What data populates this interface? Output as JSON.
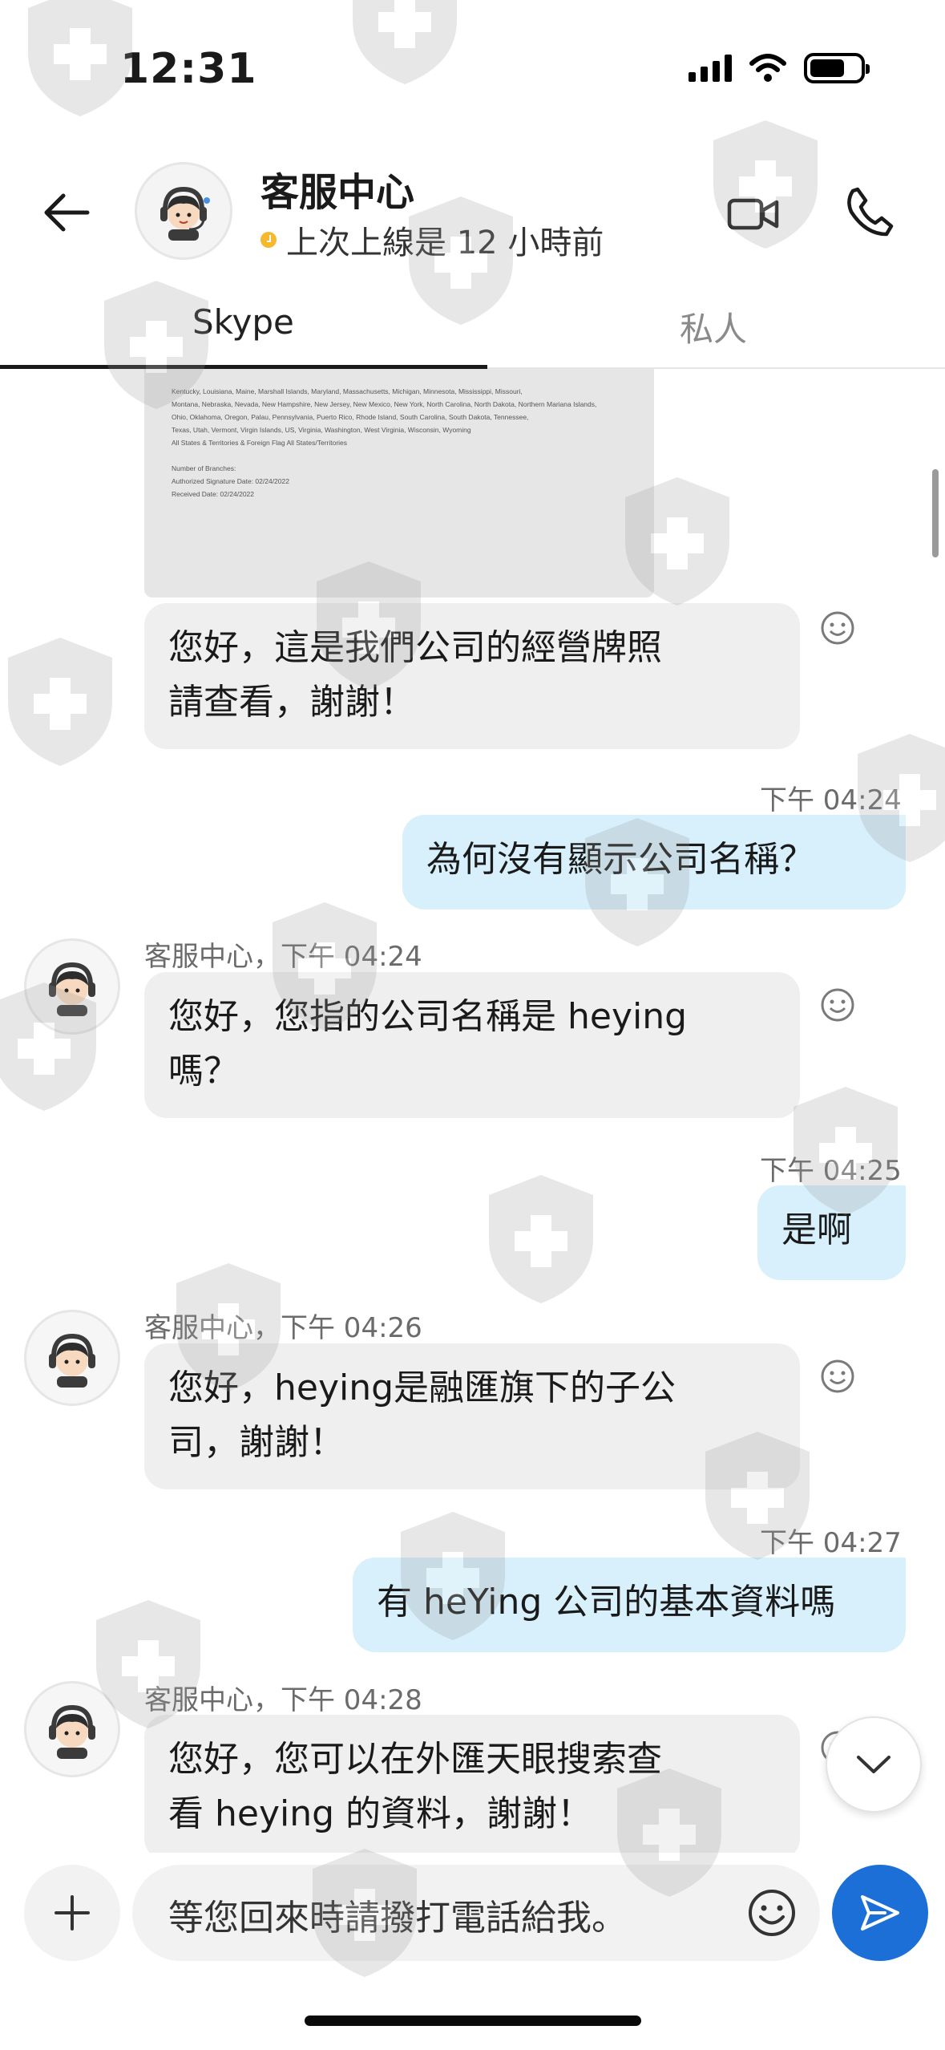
{
  "status_bar": {
    "time": "12:31"
  },
  "header": {
    "contact_name": "客服中心",
    "presence_text": "上次上線是 12 小時前",
    "presence_color": "#f5b82e"
  },
  "tabs": [
    {
      "label": "Skype",
      "active": true
    },
    {
      "label": "私人",
      "active": false
    }
  ],
  "document_preview": {
    "lines": [
      "Kentucky, Louisiana, Maine, Marshall Islands, Maryland, Massachusetts, Michigan, Minnesota, Mississippi, Missouri,",
      "Montana, Nebraska, Nevada, New Hampshire, New Jersey, New Mexico, New York, North Carolina, North Dakota, Northern Mariana Islands,",
      "Ohio, Oklahoma, Oregon, Palau, Pennsylvania, Puerto Rico, Rhode Island, South Carolina, South Dakota, Tennessee,",
      "Texas, Utah, Vermont, Virgin Islands, US, Virginia, Washington, West Virginia, Wisconsin, Wyoming",
      "All States & Territories & Foreign Flag   All States/Territories",
      "Number of Branches:",
      "Authorized Signature Date: 02/24/2022",
      "Received Date: 02/24/2022"
    ]
  },
  "messages": [
    {
      "direction": "in",
      "text_lines": [
        "您好，這是我們公司的經營牌照",
        "請查看，謝謝！"
      ]
    },
    {
      "direction": "out",
      "time": "下午 04:24",
      "text_lines": [
        "為何沒有顯示公司名稱？"
      ]
    },
    {
      "direction": "in",
      "meta": "客服中心，下午 04:24",
      "text_lines": [
        "您好，您指的公司名稱是 heying",
        "嗎？"
      ]
    },
    {
      "direction": "out",
      "time": "下午 04:25",
      "text_lines": [
        "是啊"
      ]
    },
    {
      "direction": "in",
      "meta": "客服中心，下午 04:26",
      "text_lines": [
        "您好，heying是融匯旗下的子公",
        "司，謝謝！"
      ]
    },
    {
      "direction": "out",
      "time": "下午 04:27",
      "text_lines": [
        "有 heYing 公司的基本資料嗎"
      ]
    },
    {
      "direction": "in",
      "meta": "客服中心，下午 04:28",
      "text_lines": [
        "您好，您可以在外匯天眼搜索查",
        "看 heying 的資料，謝謝！"
      ]
    }
  ],
  "composer": {
    "input_value": "等您回來時請撥打電話給我。"
  },
  "colors": {
    "incoming_bubble": "#efefef",
    "outgoing_bubble": "#d7f0fb",
    "send_button": "#1b6fd6"
  },
  "icons": {
    "back": "arrow-left-icon",
    "video": "video-camera-icon",
    "call": "phone-icon",
    "react": "smiley-icon",
    "add": "plus-icon",
    "emoji": "emoji-icon",
    "send": "send-icon",
    "scroll_down": "chevron-down-icon"
  }
}
